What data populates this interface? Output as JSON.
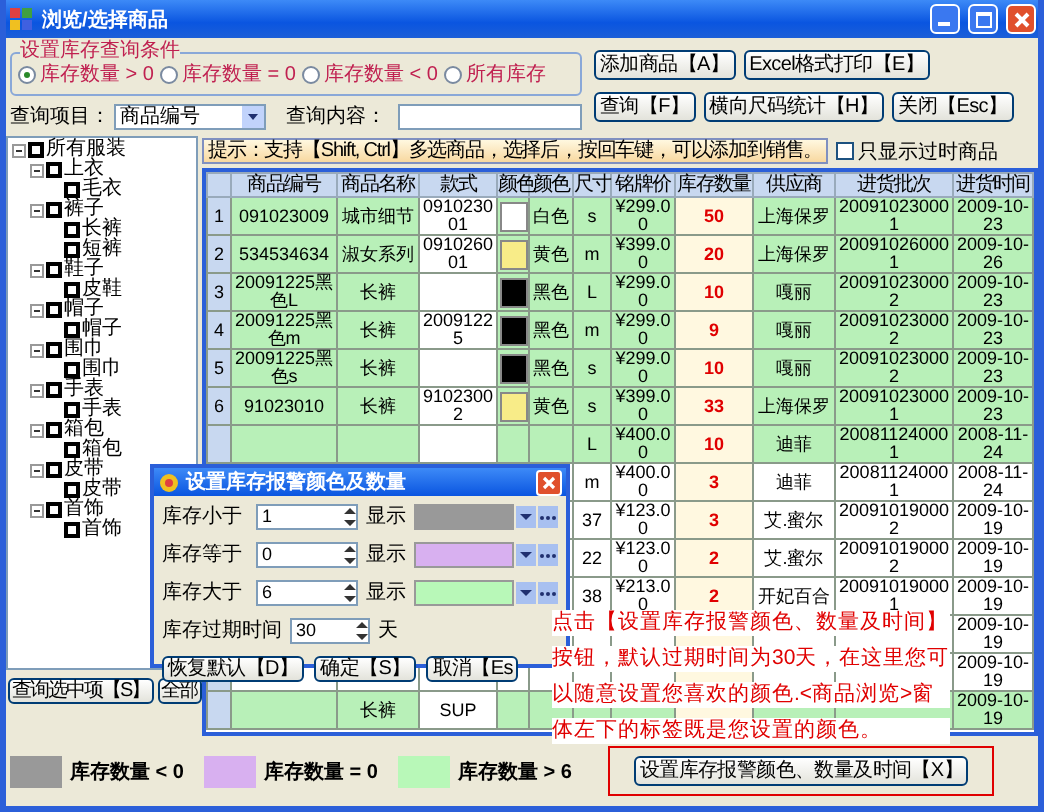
{
  "window": {
    "title": "浏览/选择商品"
  },
  "filter_group": {
    "title": "设置库存查询条件",
    "options": [
      {
        "label": "库存数量 > 0",
        "selected": true
      },
      {
        "label": "库存数量 = 0",
        "selected": false
      },
      {
        "label": "库存数量 < 0",
        "selected": false
      },
      {
        "label": "所有库存",
        "selected": false
      }
    ]
  },
  "query": {
    "item_label": "查询项目：",
    "item_value": "商品编号",
    "content_label": "查询内容："
  },
  "top_buttons": [
    "添加商品【A】",
    "Excel格式打印【E】",
    "查询【F】",
    "横向尺码统计【H】",
    "关闭【Esc】"
  ],
  "tree": [
    {
      "label": "所有服装",
      "checked": false,
      "expanded": true,
      "children": [
        {
          "label": "上衣",
          "checked": false,
          "expanded": true,
          "children": [
            {
              "label": "毛衣",
              "checked": false
            }
          ]
        },
        {
          "label": "裤子",
          "checked": false,
          "expanded": true,
          "children": [
            {
              "label": "长裤",
              "checked": false
            },
            {
              "label": "短裤",
              "checked": false
            }
          ]
        },
        {
          "label": "鞋子",
          "checked": false,
          "expanded": true,
          "children": [
            {
              "label": "皮鞋",
              "checked": false
            }
          ]
        },
        {
          "label": "帽子",
          "checked": false,
          "expanded": true,
          "children": [
            {
              "label": "帽子",
              "checked": false
            }
          ]
        },
        {
          "label": "围巾",
          "checked": false,
          "expanded": true,
          "children": [
            {
              "label": "围巾",
              "checked": false
            }
          ]
        },
        {
          "label": "手表",
          "checked": false,
          "expanded": true,
          "children": [
            {
              "label": "手表",
              "checked": false
            }
          ]
        },
        {
          "label": "箱包",
          "checked": false,
          "expanded": true,
          "children": [
            {
              "label": "箱包",
              "checked": false
            }
          ]
        },
        {
          "label": "皮带",
          "checked": false,
          "expanded": true,
          "children": [
            {
              "label": "皮带",
              "checked": false
            }
          ]
        },
        {
          "label": "首饰",
          "checked": false,
          "expanded": true,
          "children": [
            {
              "label": "首饰",
              "checked": false
            }
          ]
        }
      ]
    }
  ],
  "tree_buttons": [
    "查询选中项【S】",
    "全部"
  ],
  "hint": "提示：支持【Shift, Ctrl】多选商品，选择后，按回车键，可以添加到销售。",
  "overdue_filter": {
    "label": "只显示过时商品",
    "checked": false
  },
  "table": {
    "columns": [
      {
        "kind": "rownum"
      },
      {
        "label": "商品编号",
        "kind": "text"
      },
      {
        "label": "商品名称",
        "kind": "text"
      },
      {
        "label": "款式",
        "kind": "plain"
      },
      {
        "label": "颜色",
        "kind": "swatch"
      },
      {
        "label": "颜色",
        "kind": "text"
      },
      {
        "label": "尺寸",
        "kind": "text"
      },
      {
        "label": "铭牌价",
        "kind": "text"
      },
      {
        "label": "库存数量",
        "kind": "qty"
      },
      {
        "label": "供应商",
        "kind": "text"
      },
      {
        "label": "进货批次",
        "kind": "text"
      },
      {
        "label": "进货时间",
        "kind": "text"
      }
    ],
    "rows": [
      {
        "highlighted": true,
        "color": "#ffffff",
        "cells": [
          "1",
          "091023009",
          "城市细节",
          "091023001",
          null,
          "白色",
          "s",
          "¥299.00",
          "50",
          "上海保罗",
          "200910230001",
          "2009-10-23"
        ]
      },
      {
        "highlighted": true,
        "color": "#f8ec88",
        "cells": [
          "2",
          "534534634",
          "淑女系列",
          "091026001",
          null,
          "黄色",
          "m",
          "¥399.00",
          "20",
          "上海保罗",
          "200910260001",
          "2009-10-26"
        ]
      },
      {
        "highlighted": true,
        "color": "#000000",
        "cells": [
          "3",
          "20091225黑色L",
          "长裤",
          null,
          null,
          "黑色",
          "L",
          "¥299.00",
          "10",
          "嘎丽",
          "200910230002",
          "2009-10-23"
        ]
      },
      {
        "highlighted": true,
        "color": "#000000",
        "cells": [
          "4",
          "20091225黑色m",
          "长裤",
          "20091225",
          null,
          "黑色",
          "m",
          "¥299.00",
          "9",
          "嘎丽",
          "200910230002",
          "2009-10-23"
        ]
      },
      {
        "highlighted": true,
        "color": "#000000",
        "cells": [
          "5",
          "20091225黑色s",
          "长裤",
          null,
          null,
          "黑色",
          "s",
          "¥299.00",
          "10",
          "嘎丽",
          "200910230002",
          "2009-10-23"
        ]
      },
      {
        "highlighted": true,
        "color": "#f8ec88",
        "cells": [
          "6",
          "91023010",
          "长裤",
          "91023002",
          null,
          "黄色",
          "s",
          "¥399.00",
          "33",
          "上海保罗",
          "200910230001",
          "2009-10-23"
        ]
      },
      {
        "highlighted": true,
        "cells": [
          null,
          null,
          null,
          null,
          null,
          null,
          "L",
          "¥400.00",
          "10",
          "迪菲",
          "200811240001",
          "2008-11-24"
        ]
      },
      {
        "highlighted": false,
        "cells": [
          null,
          null,
          null,
          null,
          null,
          null,
          "m",
          "¥400.00",
          "3",
          "迪菲",
          "200811240001",
          "2008-11-24"
        ]
      },
      {
        "highlighted": false,
        "cells": [
          null,
          null,
          null,
          null,
          null,
          null,
          "37",
          "¥123.00",
          "3",
          "艾.蜜尔",
          "200910190002",
          "2009-10-19"
        ]
      },
      {
        "highlighted": false,
        "cells": [
          null,
          null,
          null,
          null,
          null,
          null,
          "22",
          "¥123.00",
          "2",
          "艾.蜜尔",
          "200910190002",
          "2009-10-19"
        ]
      },
      {
        "highlighted": false,
        "cells": [
          null,
          null,
          null,
          null,
          null,
          null,
          "38",
          "¥213.00",
          "2",
          "开妃百合",
          "200910190001",
          "2009-10-19"
        ]
      },
      {
        "highlighted": false,
        "cells": [
          null,
          null,
          null,
          null,
          null,
          null,
          null,
          null,
          null,
          null,
          null,
          "2009-10-19"
        ]
      },
      {
        "highlighted": false,
        "cells": [
          null,
          null,
          null,
          null,
          null,
          null,
          null,
          null,
          null,
          null,
          null,
          "2009-10-19"
        ]
      },
      {
        "highlighted": true,
        "cells": [
          null,
          null,
          "长裤",
          "SUP",
          null,
          null,
          null,
          null,
          null,
          null,
          null,
          "2009-10-19"
        ]
      }
    ]
  },
  "dialog": {
    "title": "设置库存报警颜色及数量",
    "thresholds": [
      {
        "label": "库存小于",
        "value": "1",
        "display_label": "显示",
        "color": "#999999"
      },
      {
        "label": "库存等于",
        "value": "0",
        "display_label": "显示",
        "color": "#d8b0f0"
      },
      {
        "label": "库存大于",
        "value": "6",
        "display_label": "显示",
        "color": "#b8f8b8"
      }
    ],
    "expiry": {
      "label": "库存过期时间",
      "value": "30",
      "unit": "天"
    },
    "buttons": [
      "恢复默认【D】",
      "确定【S】",
      "取消【Es"
    ]
  },
  "legend": [
    {
      "label": "库存数量 < 0",
      "color": "#999999"
    },
    {
      "label": "库存数量 = 0",
      "color": "#d8b0f0"
    },
    {
      "label": "库存数量 > 6",
      "color": "#b8f8b8"
    }
  ],
  "alarm_button": "设置库存报警颜色、数量及时间【X】",
  "annotation": {
    "lines": [
      "点击【设置库存报警颜色、数量及时间】",
      "按钮，默认过期时间为30天，在这里您可",
      "以随意设置您喜欢的颜色.<商品浏览>窗",
      "体左下的标签既是您设置的颜色。"
    ]
  }
}
